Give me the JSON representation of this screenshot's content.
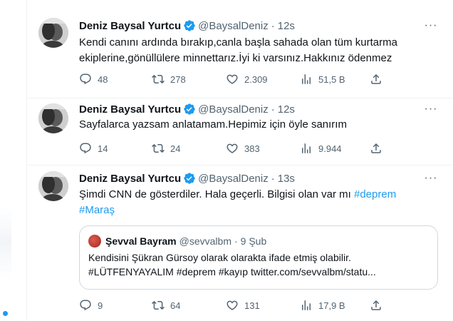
{
  "tweets": [
    {
      "name": "Deniz Baysal Yurtcu",
      "handle": "@BaysalDeniz",
      "time": "12s",
      "text": "Kendi canını ardında bırakıp,canla başla sahada olan tüm kurtarma ekiplerine,gönüllülere minnettarız.İyi ki varsınız.Hakkınız ödenmez",
      "replies": "48",
      "retweets": "278",
      "likes": "2.309",
      "views": "51,5 B"
    },
    {
      "name": "Deniz Baysal Yurtcu",
      "handle": "@BaysalDeniz",
      "time": "12s",
      "text": "Sayfalarca yazsam anlatamam.Hepimiz için öyle sanırım",
      "replies": "14",
      "retweets": "24",
      "likes": "383",
      "views": "9.944"
    },
    {
      "name": "Deniz Baysal Yurtcu",
      "handle": "@BaysalDeniz",
      "time": "13s",
      "text": "Şimdi CNN de gösterdiler. Hala geçerli. Bilgisi olan var mı",
      "hashtag1": "#deprem",
      "hashtag2": "#Maraş",
      "replies": "9",
      "retweets": "64",
      "likes": "131",
      "views": "17,9 B",
      "quote": {
        "name": "Şevval Bayram",
        "handle": "@sevvalbm",
        "date": "9 Şub",
        "line1": "Kendisini Şükran Gürsoy olarak olarakta ifade etmiş olabilir.",
        "line2": "#LÜTFENYAYALIM #deprem #kayıp twitter.com/sevvalbm/statu..."
      }
    }
  ],
  "separator": "·",
  "more_label": "···",
  "icons": {
    "reply": "reply-icon",
    "retweet": "retweet-icon",
    "like": "heart-icon",
    "views": "views-icon",
    "share": "share-icon",
    "verified": "verified-badge-icon",
    "more": "more-icon"
  },
  "colors": {
    "accent": "#1d9bf0",
    "text": "#0f1419",
    "secondary": "#536471",
    "border": "#eff3f4"
  }
}
